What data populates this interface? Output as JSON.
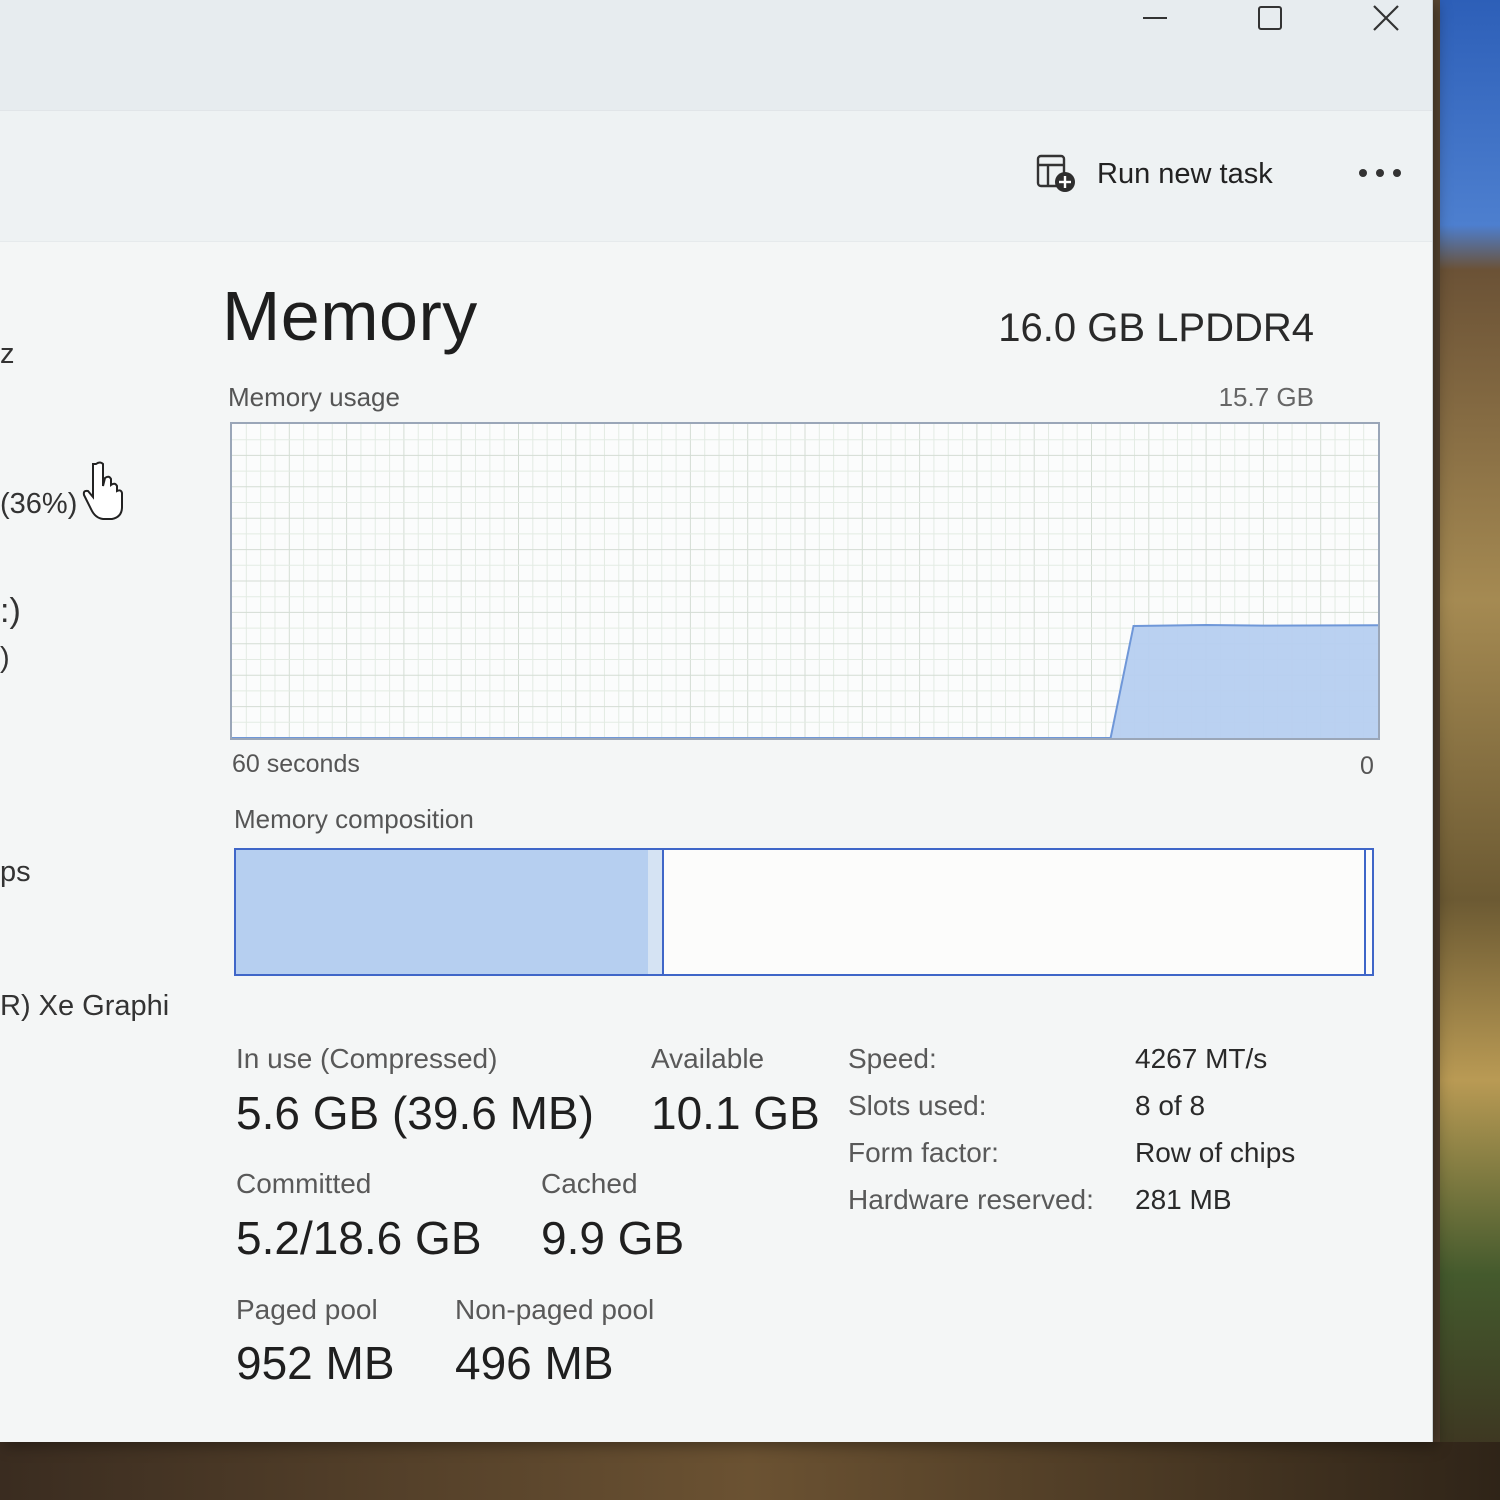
{
  "window": {
    "controls": {
      "minimize": "minimize",
      "maximize": "maximize",
      "close": "close"
    }
  },
  "toolbar": {
    "run_new_task": "Run new task",
    "more_icon": "more-options-icon"
  },
  "sidebar": {
    "partial_items": [
      "z",
      "(36%)",
      ":)",
      ")",
      "ps",
      "R) Xe Graphi"
    ]
  },
  "header": {
    "title": "Memory",
    "spec": "16.0 GB LPDDR4"
  },
  "usage_graph": {
    "label": "Memory usage",
    "max": "15.7 GB",
    "x_left": "60 seconds",
    "x_right": "0"
  },
  "composition": {
    "label": "Memory composition",
    "in_use_fraction": 0.363,
    "modified_fraction": 0.012
  },
  "stats": {
    "in_use_label": "In use (Compressed)",
    "in_use_value": "5.6 GB (39.6 MB)",
    "available_label": "Available",
    "available_value": "10.1 GB",
    "committed_label": "Committed",
    "committed_value": "5.2/18.6 GB",
    "cached_label": "Cached",
    "cached_value": "9.9 GB",
    "paged_label": "Paged pool",
    "paged_value": "952 MB",
    "nonpaged_label": "Non-paged pool",
    "nonpaged_value": "496 MB"
  },
  "details": [
    {
      "label": "Speed:",
      "value": "4267 MT/s"
    },
    {
      "label": "Slots used:",
      "value": "8 of 8"
    },
    {
      "label": "Form factor:",
      "value": "Row of chips"
    },
    {
      "label": "Hardware reserved:",
      "value": "281 MB"
    }
  ],
  "chart_data": {
    "type": "area",
    "title": "Memory usage",
    "xlabel": "",
    "ylabel": "",
    "x_range": [
      "60 seconds",
      "0"
    ],
    "ylim": [
      0,
      15.7
    ],
    "series": [
      {
        "x": [
          60,
          14,
          12.8,
          9,
          6,
          0
        ],
        "y": [
          0,
          0,
          5.6,
          5.65,
          5.62,
          5.64
        ]
      }
    ]
  },
  "colors": {
    "accent": "#3f66c8",
    "fill": "#b6cff0",
    "grid": "#e3ebe3"
  }
}
